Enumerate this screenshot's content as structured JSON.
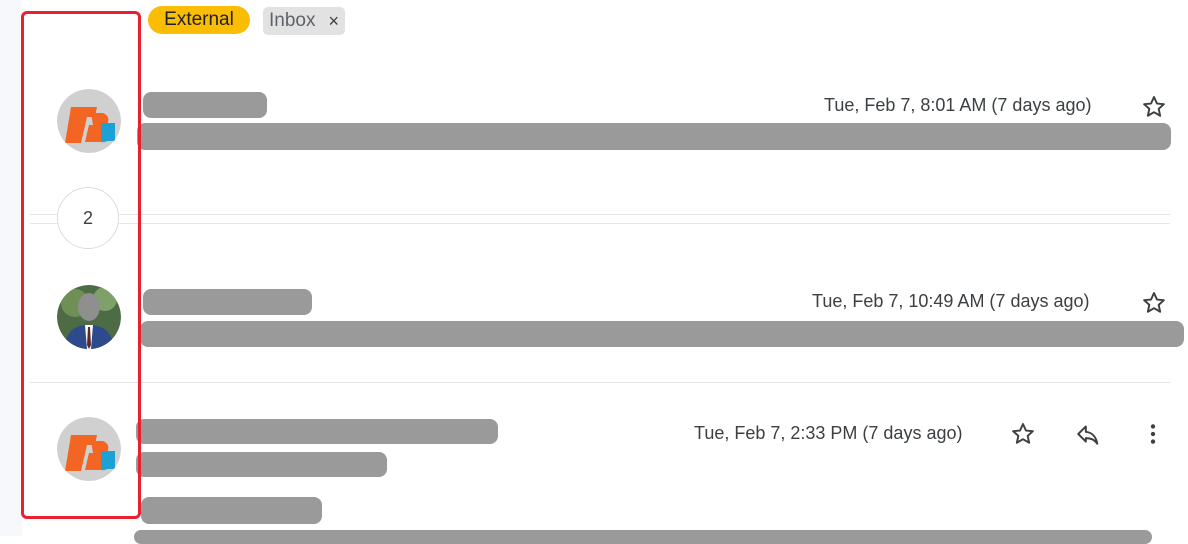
{
  "labels": {
    "external": "External",
    "inbox": "Inbox",
    "inbox_remove": "×"
  },
  "thread": {
    "collapsed_count": "2",
    "messages": [
      {
        "timestamp": "Tue, Feb 7, 8:01 AM (7 days ago)",
        "avatar": "company-logo"
      },
      {
        "timestamp": "Tue, Feb 7, 10:49 AM (7 days ago)",
        "avatar": "person-photo"
      },
      {
        "timestamp": "Tue, Feb 7, 2:33 PM (7 days ago)",
        "avatar": "company-logo"
      }
    ]
  },
  "icons": {
    "star": "star-outline-icon",
    "reply": "reply-arrow-icon",
    "more": "more-vertical-icon"
  },
  "colors": {
    "external_chip": "#fbbc04",
    "inbox_chip": "#e2e2e2",
    "redaction": "#9a9a9a",
    "highlight": "#e8202f",
    "logo_orange": "#f26522",
    "logo_blue": "#1ba1d6",
    "avatar_bg": "#d0d0d0"
  }
}
